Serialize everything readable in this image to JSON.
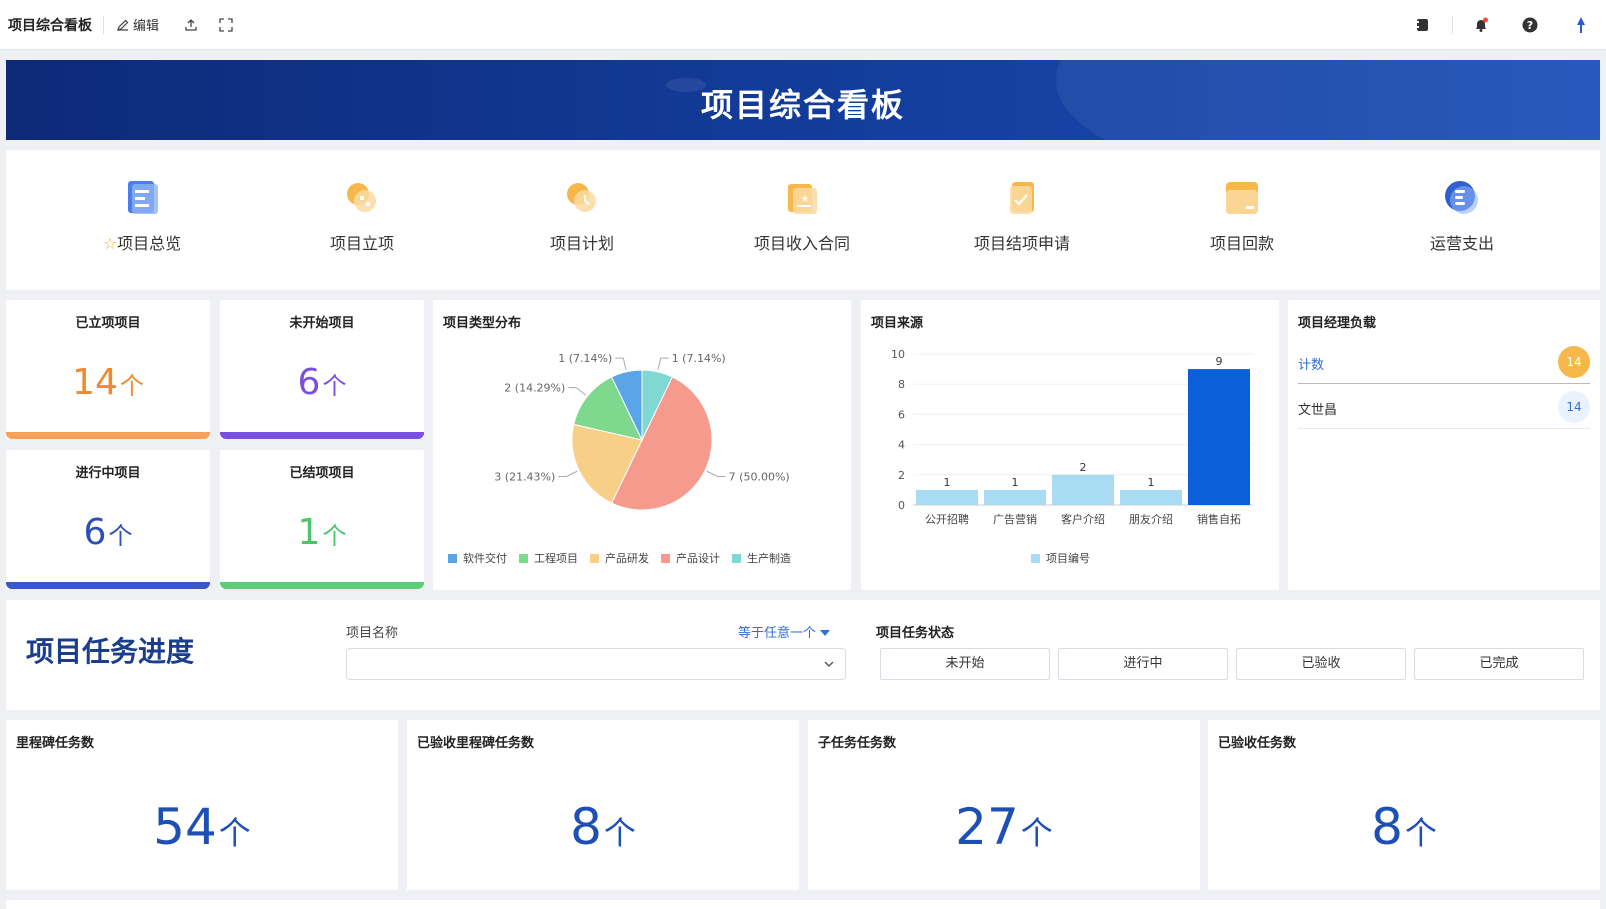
{
  "topbar": {
    "title": "项目综合看板",
    "edit_label": "编辑"
  },
  "banner": {
    "title": "项目综合看板"
  },
  "nav": {
    "items": [
      {
        "label": "项目总览"
      },
      {
        "label": "项目立项"
      },
      {
        "label": "项目计划"
      },
      {
        "label": "项目收入合同"
      },
      {
        "label": "项目结项申请"
      },
      {
        "label": "项目回款"
      },
      {
        "label": "运营支出"
      }
    ]
  },
  "stats": [
    {
      "title": "已立项项目",
      "value": "14",
      "unit": "个",
      "color": "#f08a2c",
      "bar": "#f7a25c"
    },
    {
      "title": "未开始项目",
      "value": "6",
      "unit": "个",
      "color": "#7a4fe0",
      "bar": "#7a4fe0"
    },
    {
      "title": "进行中项目",
      "value": "6",
      "unit": "个",
      "color": "#2a4fb8",
      "bar": "#3a57c9"
    },
    {
      "title": "已结项项目",
      "value": "1",
      "unit": "个",
      "color": "#4cc46a",
      "bar": "#5ccd78"
    }
  ],
  "pie_panel": {
    "title": "项目类型分布"
  },
  "bar_panel": {
    "title": "项目来源"
  },
  "load_panel": {
    "title": "项目经理负载",
    "header": {
      "name": "计数",
      "value": "14"
    },
    "rows": [
      {
        "name": "文世昌",
        "value": "14"
      }
    ]
  },
  "chart_data": [
    {
      "type": "pie",
      "slices": [
        {
          "label": "软件交付",
          "value": 1,
          "text": "1 (7.14%)",
          "color": "#5aa5e8"
        },
        {
          "label": "工程项目",
          "value": 2,
          "text": "2 (14.29%)",
          "color": "#7ed98e"
        },
        {
          "label": "产品研发",
          "value": 3,
          "text": "3 (21.43%)",
          "color": "#f7cf86"
        },
        {
          "label": "产品设计",
          "value": 7,
          "text": "7 (50.00%)",
          "color": "#f59a8c"
        },
        {
          "label": "生产制造",
          "value": 1,
          "text": "1 (7.14%)",
          "color": "#7fd8d2"
        }
      ]
    },
    {
      "type": "bar",
      "categories": [
        "公开招聘",
        "广告营销",
        "客户介绍",
        "朋友介绍",
        "销售自拓"
      ],
      "series": [
        {
          "name": "项目编号",
          "values": [
            1,
            1,
            2,
            1,
            9
          ]
        }
      ],
      "ylim": [
        0,
        10
      ],
      "yticks": [
        "0",
        "2",
        "4",
        "6",
        "8",
        "10"
      ],
      "bar_color": "#a9dcf2",
      "highlight_color": "#0b5fd8"
    }
  ],
  "filter": {
    "section_title": "项目任务进度",
    "field_label": "项目名称",
    "operator": "等于任意一个",
    "status_title": "项目任务状态",
    "status_buttons": [
      "未开始",
      "进行中",
      "已验收",
      "已完成"
    ]
  },
  "kpis": [
    {
      "title": "里程碑任务数",
      "value": "54",
      "unit": "个"
    },
    {
      "title": "已验收里程碑任务数",
      "value": "8",
      "unit": "个"
    },
    {
      "title": "子任务任务数",
      "value": "27",
      "unit": "个"
    },
    {
      "title": "已验收任务数",
      "value": "8",
      "unit": "个"
    }
  ]
}
